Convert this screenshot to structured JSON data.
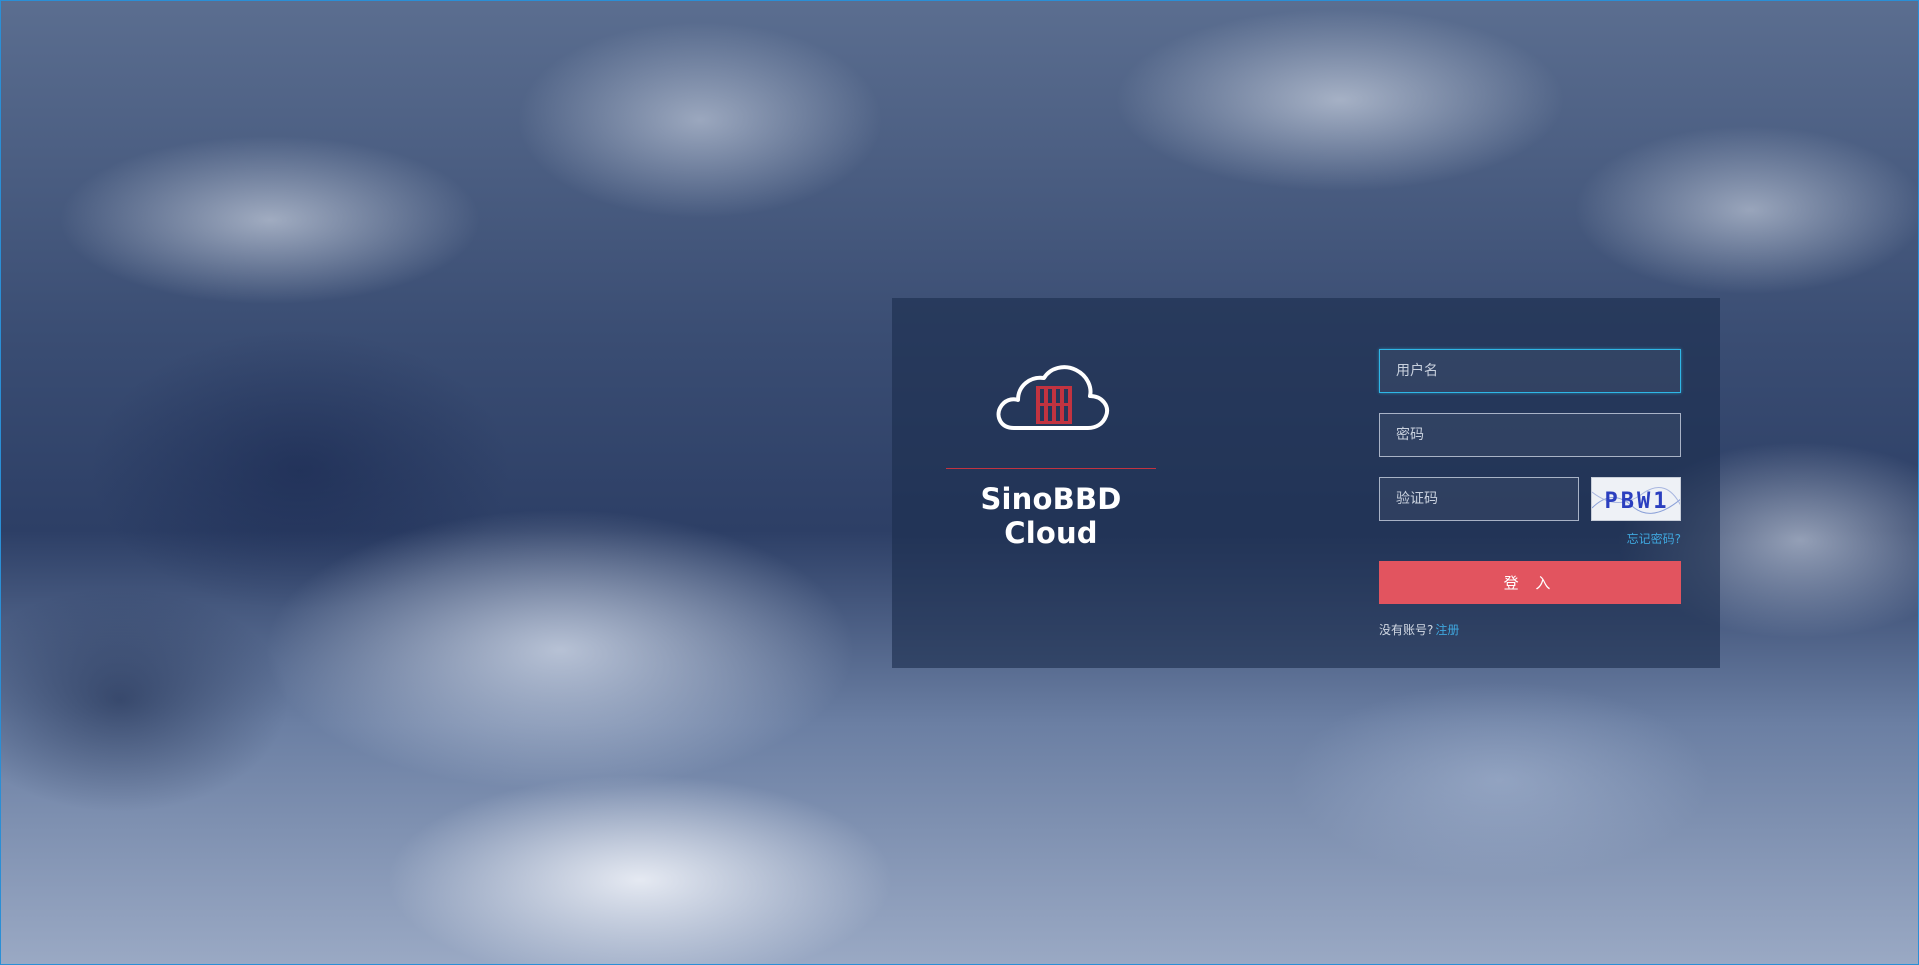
{
  "brand": {
    "name": "SinoBBD Cloud",
    "logo_icon": "cloud-building-icon",
    "accent_color": "#c23340"
  },
  "login_form": {
    "username_placeholder": "用户名",
    "password_placeholder": "密码",
    "captcha_placeholder": "验证码",
    "captcha_text": "PBW1",
    "forgot_password": "忘记密码?",
    "login_button": "登 入",
    "no_account_text": "没有账号?",
    "register_link": "注册"
  },
  "colors": {
    "button": "#e2545f",
    "link": "#3fa7de",
    "focus_border": "#2fb6e6"
  }
}
